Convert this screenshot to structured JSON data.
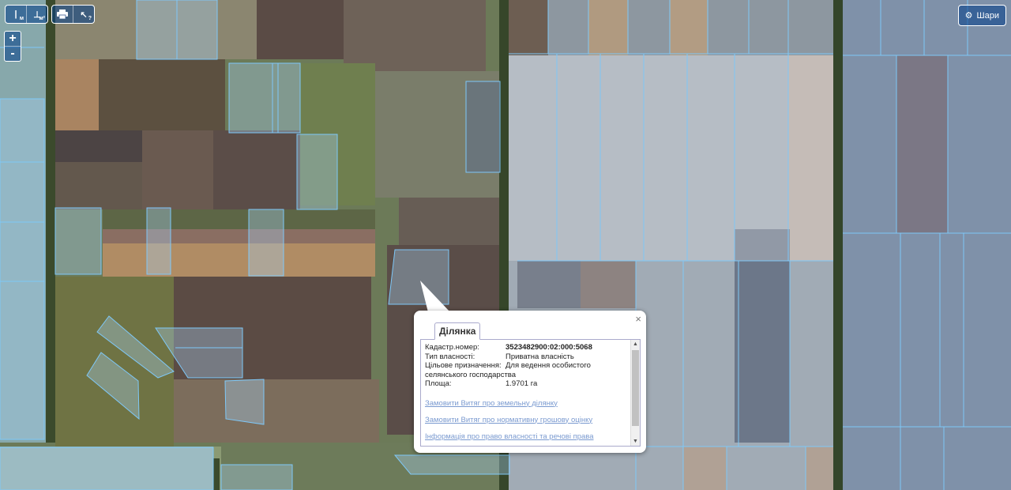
{
  "toolbar": {
    "measure_length": {
      "icon": "ruler-line-icon",
      "label": "м"
    },
    "measure_area": {
      "icon": "ruler-area-icon",
      "label": "м²"
    },
    "print": {
      "icon": "print-icon"
    },
    "identify": {
      "icon": "cursor-question-icon",
      "label": "?"
    }
  },
  "zoom": {
    "in": "+",
    "out": "-"
  },
  "layers_button": {
    "icon": "gear-icon",
    "label": "Шари"
  },
  "popup": {
    "tab": "Ділянка",
    "close": "×",
    "fields": [
      {
        "key": "Кадастр.номер:",
        "value": "3523482900:02:000:5068"
      },
      {
        "key": "Тип власності:",
        "value": "Приватна власність"
      },
      {
        "key": "Цільове призначення:",
        "value": "Для ведення особистого"
      },
      {
        "key": "",
        "value": "селянського господарства"
      },
      {
        "key": "Площа:",
        "value": "1.9701 га"
      }
    ],
    "links": [
      "Замовити Витяг про земельну ділянку",
      "Замовити Витяг про нормативну грошову оцінку",
      "Інформація про право власності та речові права"
    ]
  },
  "colors": {
    "parcel_outline": "#7ec8f8",
    "parcel_fill": "#a8d4f5",
    "control_bg": "#003c88",
    "link": "#7a9ad0"
  }
}
